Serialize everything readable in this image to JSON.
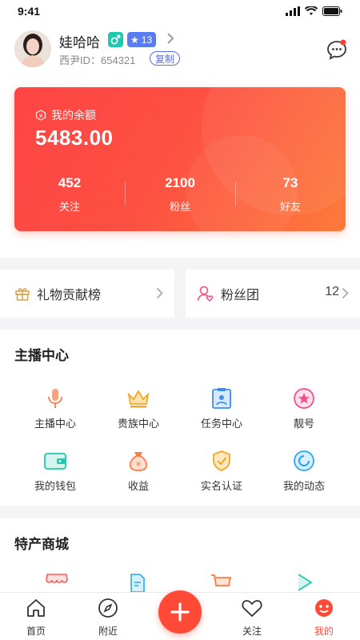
{
  "status_bar": {
    "time": "9:41"
  },
  "profile": {
    "nickname": "娃哈哈",
    "level": "13",
    "id_text": "西尹ID：654321",
    "copy_label": "复制"
  },
  "balance_card": {
    "label": "我的余额",
    "amount": "5483.00",
    "stats": [
      {
        "value": "452",
        "label": "关注"
      },
      {
        "value": "2100",
        "label": "粉丝"
      },
      {
        "value": "73",
        "label": "好友"
      }
    ]
  },
  "quick_links": {
    "gift_label": "礼物贡献榜",
    "fans_label": "粉丝团",
    "fans_count": "12"
  },
  "anchor_center": {
    "title": "主播中心",
    "items": [
      {
        "label": "主播中心",
        "icon": "microphone-icon"
      },
      {
        "label": "贵族中心",
        "icon": "crown-icon"
      },
      {
        "label": "任务中心",
        "icon": "task-icon"
      },
      {
        "label": "靓号",
        "icon": "star-badge-icon"
      },
      {
        "label": "我的钱包",
        "icon": "wallet-icon"
      },
      {
        "label": "收益",
        "icon": "money-bag-icon"
      },
      {
        "label": "实名认证",
        "icon": "verified-shield-icon"
      },
      {
        "label": "我的动态",
        "icon": "activity-icon"
      }
    ]
  },
  "mall": {
    "title": "特产商城"
  },
  "bottom_nav": {
    "items": [
      {
        "label": "首页",
        "icon": "home-icon"
      },
      {
        "label": "附近",
        "icon": "compass-icon"
      },
      {
        "label": "关注",
        "icon": "heart-icon"
      },
      {
        "label": "我的",
        "icon": "profile-icon"
      }
    ],
    "active": "我的"
  },
  "colors": {
    "accent": "#ff4a38",
    "card_gradient_start": "#ff4545",
    "card_gradient_end": "#fd7a3a",
    "badge_gender": "#1fc8b0",
    "badge_level": "#5a7cf0"
  }
}
